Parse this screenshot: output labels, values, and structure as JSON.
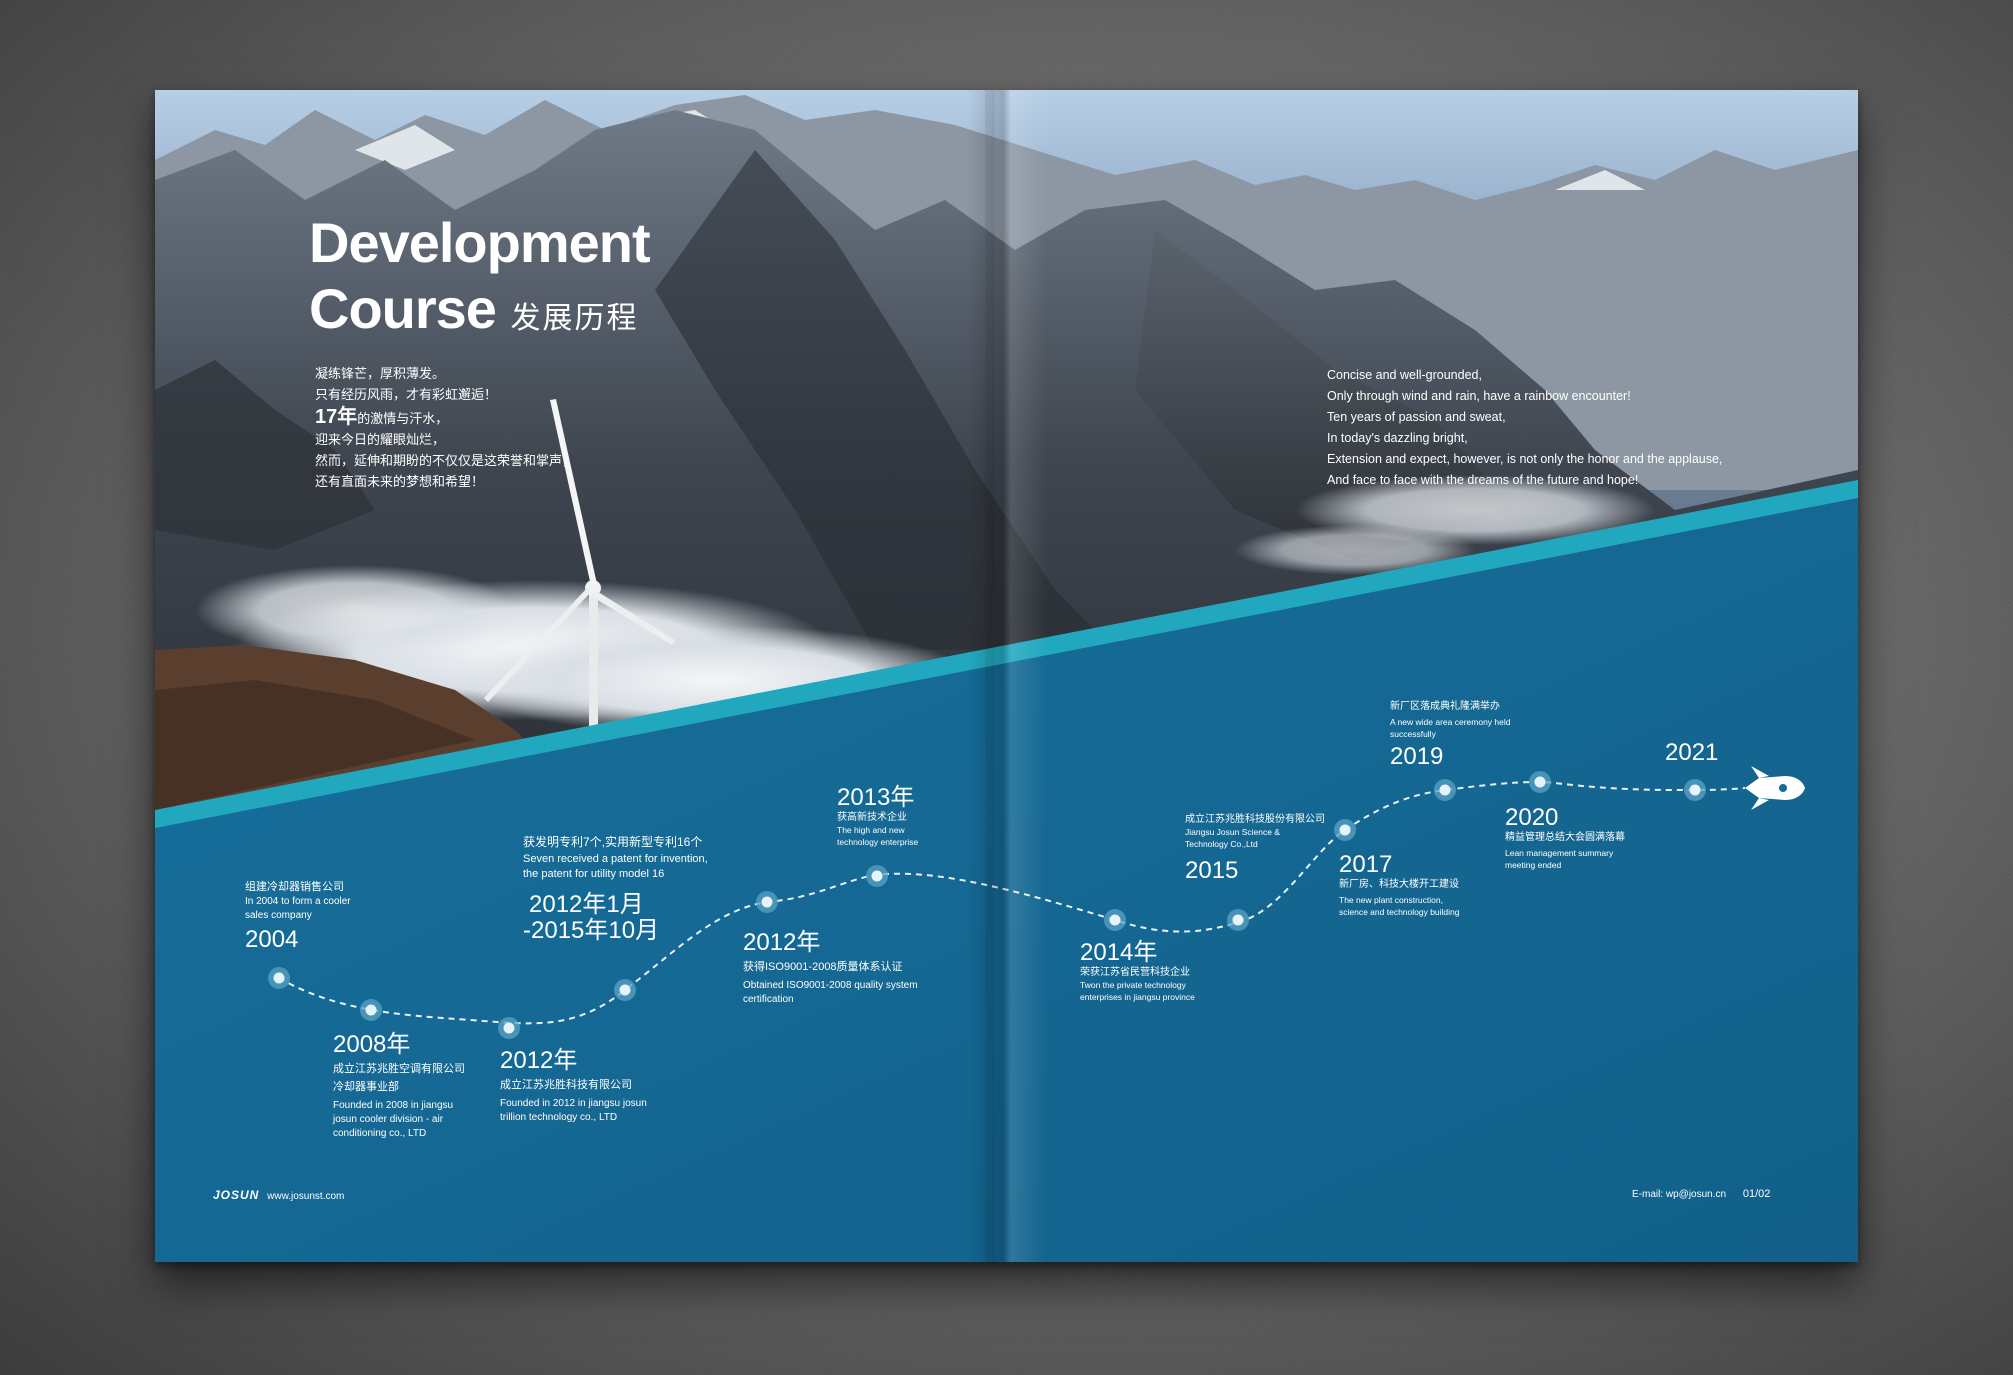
{
  "brochure": {
    "title_line1": "Development",
    "title_line2": "Course",
    "title_cn": "发展历程",
    "intro_cn": [
      "凝练锋芒，厚积薄发。",
      "只有经历风雨，才有彩虹邂逅！"
    ],
    "intro_big": "17年",
    "intro_big_suffix": "的激情与汗水，",
    "intro_cn2": [
      "迎来今日的耀眼灿烂，",
      "然而，延伸和期盼的不仅仅是这荣誉和掌声，",
      "还有直面未来的梦想和希望！"
    ],
    "intro_en": [
      "Concise and well-grounded,",
      "Only through wind and rain, have a rainbow encounter!",
      "Ten years of passion and sweat,",
      "In today's dazzling bright,",
      "Extension and expect, however, is not only the honor and the applause,",
      "And face to face with the dreams of the future and hope!"
    ],
    "footer": {
      "logo": "JOSUN",
      "website": "www.josunst.com",
      "email": "E-mail: wp@josun.cn",
      "page": "01/02"
    },
    "colors": {
      "blue": "#156a96",
      "teal": "#22a8be",
      "white": "#ffffff"
    }
  },
  "timeline": [
    {
      "year": "2004",
      "cn": "组建冷却器销售公司",
      "en": [
        "In 2004 to form a cooler",
        "sales company"
      ]
    },
    {
      "year": "2008年",
      "cn": [
        "成立江苏兆胜空调有限公司",
        "冷却器事业部"
      ],
      "en": [
        "Founded  in 2008 in jiangsu",
        "josun cooler division - air",
        "conditioning co., LTD"
      ]
    },
    {
      "year": "2012年",
      "cn": "成立江苏兆胜科技有限公司",
      "en": [
        "Founded in 2012 in jiangsu  josun",
        "trillion technology co., LTD"
      ]
    },
    {
      "year_line1": "2012年1月",
      "year_line2": "-2015年10月",
      "cn": "获发明专利7个,实用新型专利16个",
      "en": [
        "Seven received a patent for invention,",
        "the patent for utility model 16"
      ]
    },
    {
      "year": "2012年",
      "cn": "获得ISO9001-2008质量体系认证",
      "en": [
        "Obtained ISO9001-2008 quality system",
        "certification"
      ]
    },
    {
      "year": "2013年",
      "cn": "获高新技术企业",
      "en": [
        "The high and new",
        "technology enterprise"
      ]
    },
    {
      "year": "2014年",
      "cn": "荣获江苏省民营科技企业",
      "en": [
        "Twon the private technology",
        "enterprises in jiangsu province"
      ]
    },
    {
      "year": "2015",
      "cn": "成立江苏兆胜科技股份有限公司",
      "en": [
        "Jiangsu Josun Science &",
        "Technology Co.,Ltd"
      ]
    },
    {
      "year": "2017",
      "cn": "新厂房、科技大楼开工建设",
      "en": [
        "The new plant construction,",
        "science and technology building"
      ]
    },
    {
      "year": "2019",
      "cn": "新厂区落成典礼隆满举办",
      "en": [
        "A new wide area ceremony held",
        "successfully"
      ]
    },
    {
      "year": "2020",
      "cn": "精益管理总结大会圆满落幕",
      "en": [
        "Lean management summary",
        "meeting ended"
      ]
    },
    {
      "year": "2021"
    }
  ]
}
